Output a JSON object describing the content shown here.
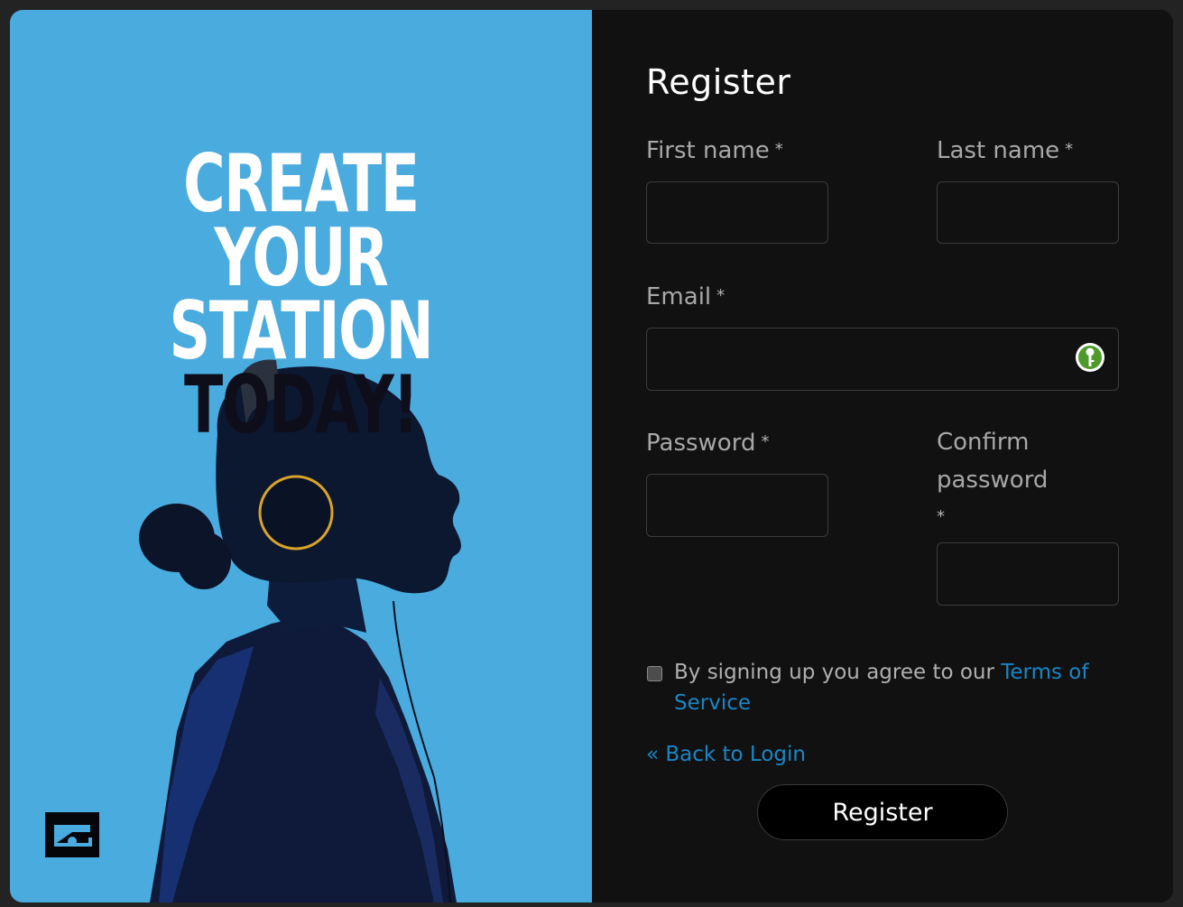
{
  "hero": {
    "headline_line1": "CREATE YOUR",
    "headline_line2": "STATION",
    "headline_line3": "TODAY!",
    "background_color": "#4aabde",
    "logo_icon": "brand-logo-icon"
  },
  "form": {
    "title": "Register",
    "first_name": {
      "label": "First name",
      "required_mark": "*",
      "value": ""
    },
    "last_name": {
      "label": "Last name",
      "required_mark": "*",
      "value": ""
    },
    "email": {
      "label": "Email",
      "required_mark": "*",
      "value": "",
      "autofill_icon": "password-manager-key-icon"
    },
    "password": {
      "label": "Password",
      "required_mark": "*",
      "value": ""
    },
    "confirm_password": {
      "label_line1": "Confirm",
      "label_line2": "password",
      "required_mark": "*",
      "value": ""
    },
    "terms": {
      "checked": false,
      "text": "By signing up you agree to our ",
      "link_text_line1": "Terms of",
      "link_text_line2": "Service"
    },
    "back_to_login": "« Back to Login",
    "submit_label": "Register"
  },
  "colors": {
    "panel_bg": "#111111",
    "link": "#1a86c5",
    "label": "#a8a8a8"
  }
}
